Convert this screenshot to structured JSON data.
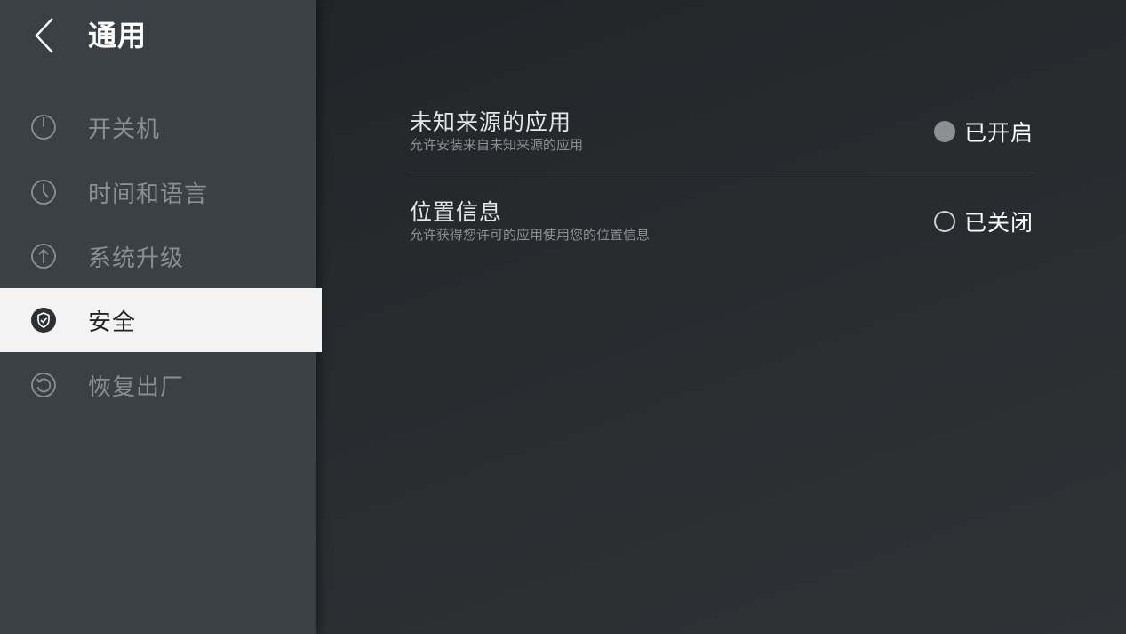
{
  "header": {
    "title": "通用"
  },
  "sidebar": {
    "items": [
      {
        "label": "开关机",
        "icon": "power-icon",
        "active": false
      },
      {
        "label": "时间和语言",
        "icon": "clock-icon",
        "active": false
      },
      {
        "label": "系统升级",
        "icon": "upgrade-arrow-icon",
        "active": false
      },
      {
        "label": "安全",
        "icon": "shield-icon",
        "active": true
      },
      {
        "label": "恢复出厂",
        "icon": "reset-icon",
        "active": false
      }
    ]
  },
  "settings": [
    {
      "title": "未知来源的应用",
      "description": "允许安装来自未知来源的应用",
      "status": "已开启",
      "enabled": true
    },
    {
      "title": "位置信息",
      "description": "允许获得您许可的应用使用您的位置信息",
      "status": "已关闭",
      "enabled": false
    }
  ],
  "colors": {
    "sidebar_bg": "#3a4043",
    "active_item_bg": "#f3f3f3",
    "inactive_text": "#8a8f92",
    "on_indicator": "#8d8f90"
  }
}
